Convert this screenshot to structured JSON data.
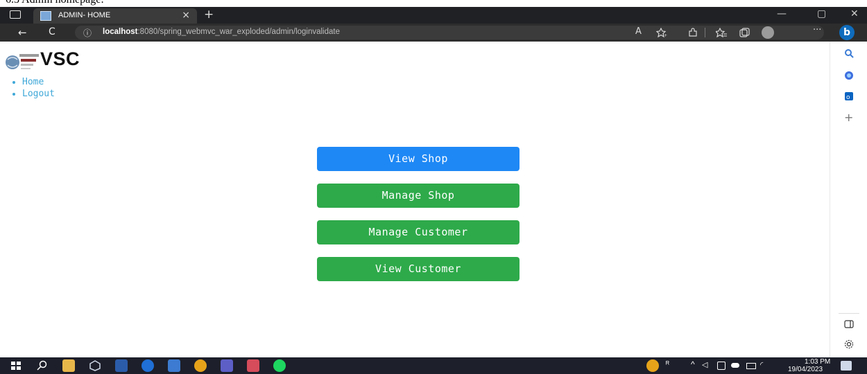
{
  "caption": "6.3 Admin homepage:",
  "browser": {
    "tab_title": "ADMIN- HOME",
    "tab_close": "×",
    "new_tab": "+",
    "url_host": "localhost",
    "url_rest": ":8080/spring_webmvc_war_exploded/admin/loginvalidate",
    "info_icon": "ⓘ",
    "back_icon": "←",
    "refresh_icon": "C",
    "read_aloud_icon": "A",
    "more_icon": "···",
    "minimize_icon": "—",
    "maximize_icon": "▢",
    "close_icon": "✕"
  },
  "page": {
    "brand": "VSC",
    "nav": [
      {
        "label": "Home"
      },
      {
        "label": "Logout"
      }
    ],
    "buttons": [
      {
        "label": "View Shop",
        "color": "#1e88f5"
      },
      {
        "label": "Manage Shop",
        "color": "#2eaa4a"
      },
      {
        "label": "Manage Customer",
        "color": "#2eaa4a"
      },
      {
        "label": "View Customer",
        "color": "#2eaa4a"
      }
    ]
  },
  "sidebar": {
    "add_icon": "+"
  },
  "taskbar": {
    "time": "1:03 PM",
    "date": "19/04/2023"
  }
}
